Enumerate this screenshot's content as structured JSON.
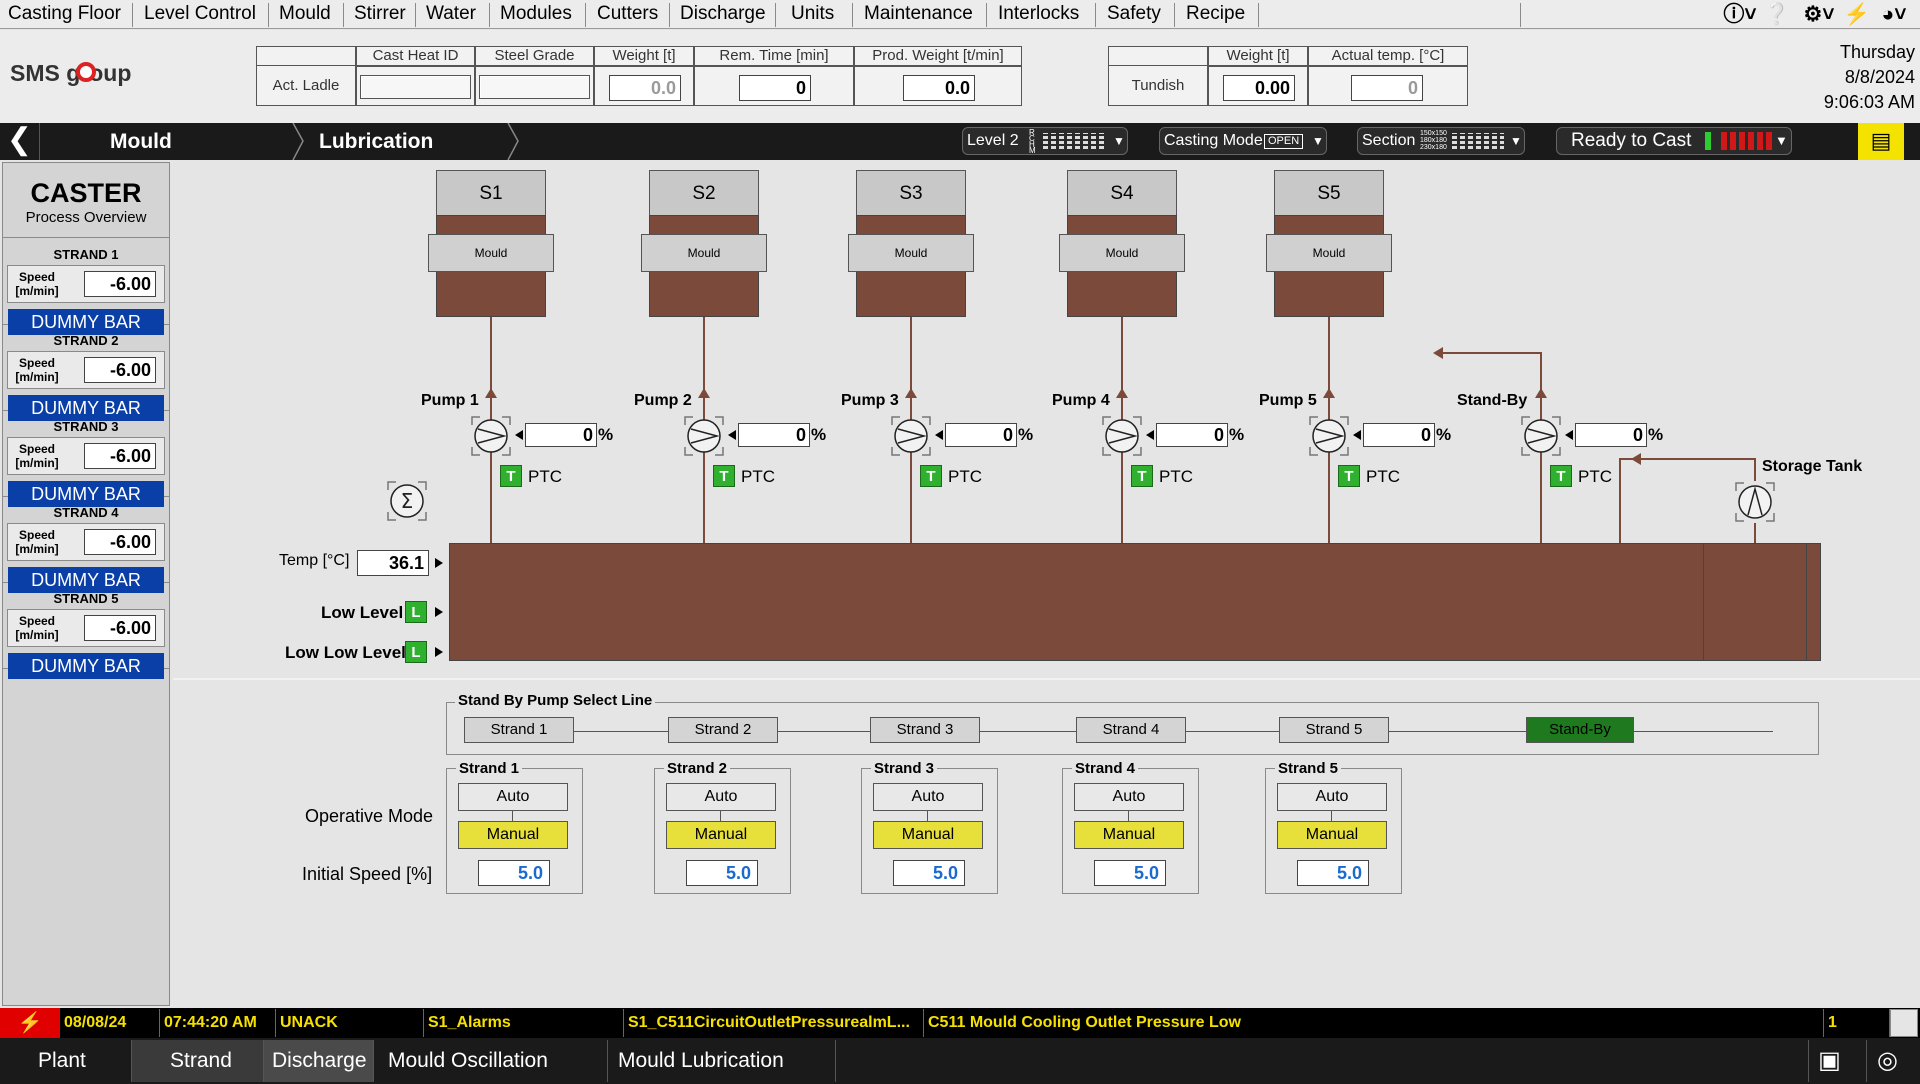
{
  "menu": [
    "Casting Floor",
    "Level Control",
    "Mould",
    "Stirrer",
    "Water",
    "Modules",
    "Cutters",
    "Discharge",
    "Units",
    "Maintenance",
    "Interlocks",
    "Safety",
    "Recipe"
  ],
  "logo": "SMS group",
  "ladle": {
    "row_label": "Act. Ladle",
    "headers": [
      "Cast Heat ID",
      "Steel Grade",
      "Weight [t]",
      "Rem. Time [min]",
      "Prod. Weight [t/min]"
    ],
    "values": [
      "",
      "",
      "0.0",
      "0",
      "0.0"
    ]
  },
  "tundish": {
    "row_label": "Tundish",
    "headers": [
      "Weight [t]",
      "Actual temp. [°C]"
    ],
    "values": [
      "0.00",
      "0"
    ]
  },
  "datetime": {
    "day": "Thursday",
    "date": "8/8/2024",
    "time": "9:06:03 AM"
  },
  "nav": {
    "crumb1": "Mould",
    "crumb2": "Lubrication",
    "level": "Level 2",
    "level_tags": [
      "R",
      "C",
      "H",
      "M"
    ],
    "casting_mode_label": "Casting Mode",
    "casting_mode_value": "OPEN",
    "section_label": "Section",
    "section_sizes": [
      "150x150",
      "180x180",
      "230x180"
    ],
    "ready": "Ready to Cast"
  },
  "sidebar": {
    "title": "CASTER",
    "subtitle": "Process Overview",
    "strands": [
      {
        "name": "STRAND 1",
        "speed_label": "Speed [m/min]",
        "speed": "-6.00",
        "status": "DUMMY BAR"
      },
      {
        "name": "STRAND 2",
        "speed_label": "Speed [m/min]",
        "speed": "-6.00",
        "status": "DUMMY BAR"
      },
      {
        "name": "STRAND 3",
        "speed_label": "Speed [m/min]",
        "speed": "-6.00",
        "status": "DUMMY BAR"
      },
      {
        "name": "STRAND 4",
        "speed_label": "Speed [m/min]",
        "speed": "-6.00",
        "status": "DUMMY BAR"
      },
      {
        "name": "STRAND 5",
        "speed_label": "Speed [m/min]",
        "speed": "-6.00",
        "status": "DUMMY BAR"
      }
    ]
  },
  "moulds": [
    {
      "name": "S1",
      "label": "Mould"
    },
    {
      "name": "S2",
      "label": "Mould"
    },
    {
      "name": "S3",
      "label": "Mould"
    },
    {
      "name": "S4",
      "label": "Mould"
    },
    {
      "name": "S5",
      "label": "Mould"
    }
  ],
  "pumps": [
    {
      "name": "Pump 1",
      "value": "0",
      "unit": "%",
      "badge": "T",
      "tag": "PTC"
    },
    {
      "name": "Pump 2",
      "value": "0",
      "unit": "%",
      "badge": "T",
      "tag": "PTC"
    },
    {
      "name": "Pump 3",
      "value": "0",
      "unit": "%",
      "badge": "T",
      "tag": "PTC"
    },
    {
      "name": "Pump 4",
      "value": "0",
      "unit": "%",
      "badge": "T",
      "tag": "PTC"
    },
    {
      "name": "Pump 5",
      "value": "0",
      "unit": "%",
      "badge": "T",
      "tag": "PTC"
    },
    {
      "name": "Stand-By",
      "value": "0",
      "unit": "%",
      "badge": "T",
      "tag": "PTC"
    }
  ],
  "storage_tank": "Storage Tank",
  "tank": {
    "temp_label": "Temp [°C]",
    "temp": "36.1",
    "low_label": "Low Level",
    "low_badge": "L",
    "lowlow_label": "Low Low Level",
    "lowlow_badge": "L"
  },
  "standby_select": {
    "title": "Stand By Pump Select Line",
    "options": [
      "Strand 1",
      "Strand 2",
      "Strand 3",
      "Strand 4",
      "Strand 5",
      "Stand-By"
    ],
    "selected": "Stand-By"
  },
  "operative": {
    "mode_label": "Operative Mode",
    "speed_label": "Initial Speed [%]",
    "strands": [
      {
        "name": "Strand 1",
        "auto": "Auto",
        "manual": "Manual",
        "speed": "5.0"
      },
      {
        "name": "Strand 2",
        "auto": "Auto",
        "manual": "Manual",
        "speed": "5.0"
      },
      {
        "name": "Strand 3",
        "auto": "Auto",
        "manual": "Manual",
        "speed": "5.0"
      },
      {
        "name": "Strand 4",
        "auto": "Auto",
        "manual": "Manual",
        "speed": "5.0"
      },
      {
        "name": "Strand 5",
        "auto": "Auto",
        "manual": "Manual",
        "speed": "5.0"
      }
    ]
  },
  "alarm": {
    "date": "08/08/24",
    "time": "07:44:20 AM",
    "state": "UNACK",
    "group": "S1_Alarms",
    "tag": "S1_C511CircuitOutletPressurealmL...",
    "message": "C511 Mould Cooling Outlet Pressure Low",
    "count": "1"
  },
  "bottom_tabs": [
    "Plant",
    "Strand",
    "Discharge",
    "Mould Oscillation",
    "Mould Lubrication"
  ],
  "colors": {
    "brown": "#7b4a3a",
    "accent_yellow": "#e8e03a",
    "dummy_blue": "#0a3fa8",
    "standby_green": "#1f7a1f",
    "alarm_yellow": "#f6e000"
  }
}
